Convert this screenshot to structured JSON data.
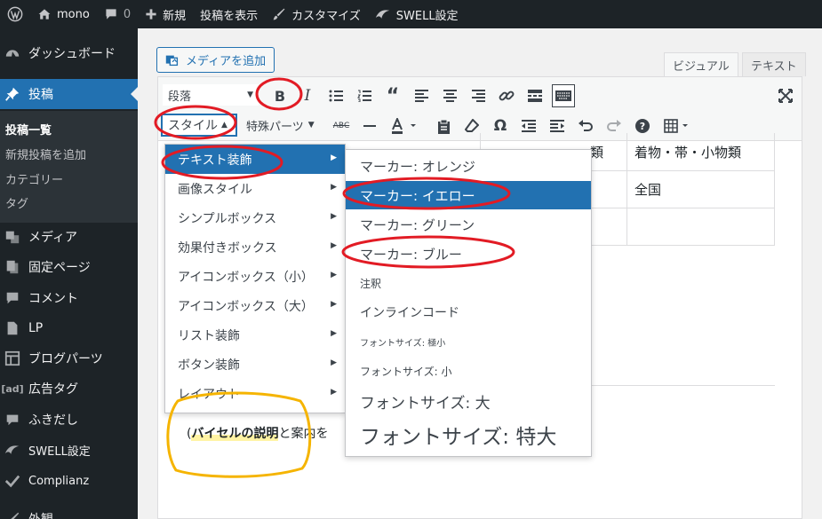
{
  "adminbar": {
    "site_name": "mono",
    "comments_count": "0",
    "new_label": "新規",
    "view_post_label": "投稿を表示",
    "customize_label": "カスタマイズ",
    "swell_settings_label": "SWELL設定"
  },
  "sidebar": {
    "items": [
      {
        "label": "ダッシュボード",
        "icon": "dashboard-icon"
      },
      {
        "label": "投稿",
        "icon": "pin-icon"
      },
      {
        "label": "メディア",
        "icon": "media-icon"
      },
      {
        "label": "固定ページ",
        "icon": "page-icon"
      },
      {
        "label": "コメント",
        "icon": "comment-icon"
      },
      {
        "label": "LP",
        "icon": "document-icon"
      },
      {
        "label": "ブログパーツ",
        "icon": "grid-icon"
      },
      {
        "label": "広告タグ",
        "icon": "ad-icon"
      },
      {
        "label": "ふきだし",
        "icon": "speech-icon"
      },
      {
        "label": "SWELL設定",
        "icon": "swell-icon"
      },
      {
        "label": "Complianz",
        "icon": "check-icon"
      },
      {
        "label": "外観",
        "icon": "brush-icon"
      }
    ],
    "submenu": [
      "投稿一覧",
      "新規投稿を追加",
      "カテゴリー",
      "タグ"
    ],
    "ad_icon_text": "[ad]"
  },
  "editor": {
    "add_media_label": "メディアを追加",
    "tab_visual": "ビジュアル",
    "tab_text": "テキスト",
    "format_select": "段落",
    "bold_label": "B",
    "italic_label": "I",
    "style_select": "スタイル",
    "special_parts": "特殊パーツ",
    "omega": "Ω",
    "help": "?"
  },
  "table": {
    "cells": [
      "着物・帯・小物類",
      "全国"
    ],
    "partial_text": "類"
  },
  "paragraph": {
    "open_paren": "(",
    "bold": "バイセルの説明",
    "rest": "と案内を"
  },
  "menu1": {
    "items": [
      "テキスト装飾",
      "画像スタイル",
      "シンプルボックス",
      "効果付きボックス",
      "アイコンボックス（小）",
      "アイコンボックス（大）",
      "リスト装飾",
      "ボタン装飾",
      "レイアウト"
    ]
  },
  "menu2": {
    "items": [
      "マーカー: オレンジ",
      "マーカー: イエロー",
      "マーカー: グリーン",
      "マーカー: ブルー",
      "注釈",
      "インラインコード",
      "フォントサイズ: 極小",
      "フォントサイズ: 小",
      "フォントサイズ: 大",
      "フォントサイズ: 特大"
    ]
  },
  "colors": {
    "admin_dark": "#1d2327",
    "accent": "#2271b1",
    "annotation_red": "#e21b24",
    "annotation_yellow": "#f5b400",
    "marker_yellow": "#fff3a3"
  }
}
